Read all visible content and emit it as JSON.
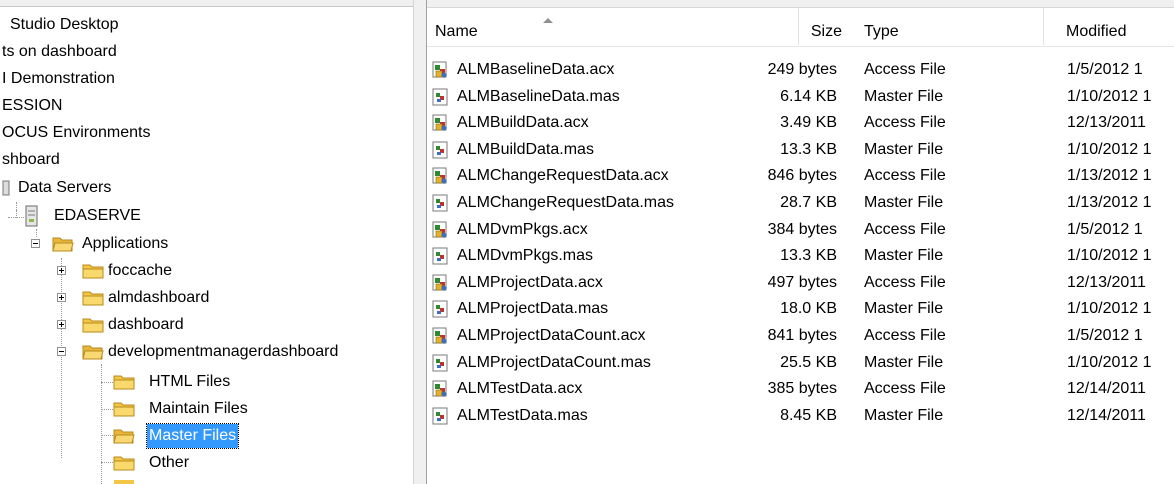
{
  "tree": {
    "items": [
      {
        "label": "Studio Desktop"
      },
      {
        "label": "ts on dashboard"
      },
      {
        "label": "I Demonstration"
      },
      {
        "label": "ESSION"
      },
      {
        "label": "OCUS Environments"
      },
      {
        "label": "shboard"
      },
      {
        "label": "Data Servers"
      },
      {
        "label": "EDASERVE"
      },
      {
        "label": "Applications"
      },
      {
        "label": "foccache"
      },
      {
        "label": "almdashboard"
      },
      {
        "label": "dashboard"
      },
      {
        "label": "developmentmanagerdashboard"
      },
      {
        "label": "HTML Files"
      },
      {
        "label": "Maintain Files"
      },
      {
        "label": "Master Files"
      },
      {
        "label": "Other"
      }
    ]
  },
  "filelist": {
    "columns": {
      "name": "Name",
      "size": "Size",
      "type": "Type",
      "modified": "Modified"
    },
    "files": [
      {
        "name": "ALMBaselineData.acx",
        "size": "249 bytes",
        "type": "Access File",
        "modified": "1/5/2012 1"
      },
      {
        "name": "ALMBaselineData.mas",
        "size": "6.14 KB",
        "type": "Master File",
        "modified": "1/10/2012 1"
      },
      {
        "name": "ALMBuildData.acx",
        "size": "3.49 KB",
        "type": "Access File",
        "modified": "12/13/2011"
      },
      {
        "name": "ALMBuildData.mas",
        "size": "13.3 KB",
        "type": "Master File",
        "modified": "1/10/2012 1"
      },
      {
        "name": "ALMChangeRequestData.acx",
        "size": "846 bytes",
        "type": "Access File",
        "modified": "1/13/2012 1"
      },
      {
        "name": "ALMChangeRequestData.mas",
        "size": "28.7 KB",
        "type": "Master File",
        "modified": "1/13/2012 1"
      },
      {
        "name": "ALMDvmPkgs.acx",
        "size": "384 bytes",
        "type": "Access File",
        "modified": "1/5/2012 1"
      },
      {
        "name": "ALMDvmPkgs.mas",
        "size": "13.3 KB",
        "type": "Master File",
        "modified": "1/10/2012 1"
      },
      {
        "name": "ALMProjectData.acx",
        "size": "497 bytes",
        "type": "Access File",
        "modified": "12/13/2011"
      },
      {
        "name": "ALMProjectData.mas",
        "size": "18.0 KB",
        "type": "Master File",
        "modified": "1/10/2012 1"
      },
      {
        "name": "ALMProjectDataCount.acx",
        "size": "841 bytes",
        "type": "Access File",
        "modified": "1/5/2012 1"
      },
      {
        "name": "ALMProjectDataCount.mas",
        "size": "25.5 KB",
        "type": "Master File",
        "modified": "1/10/2012 1"
      },
      {
        "name": "ALMTestData.acx",
        "size": "385 bytes",
        "type": "Access File",
        "modified": "12/14/2011"
      },
      {
        "name": "ALMTestData.mas",
        "size": "8.45 KB",
        "type": "Master File",
        "modified": "12/14/2011"
      }
    ]
  },
  "colors": {
    "selection": "#3399ff",
    "folder": "#f5c845"
  }
}
